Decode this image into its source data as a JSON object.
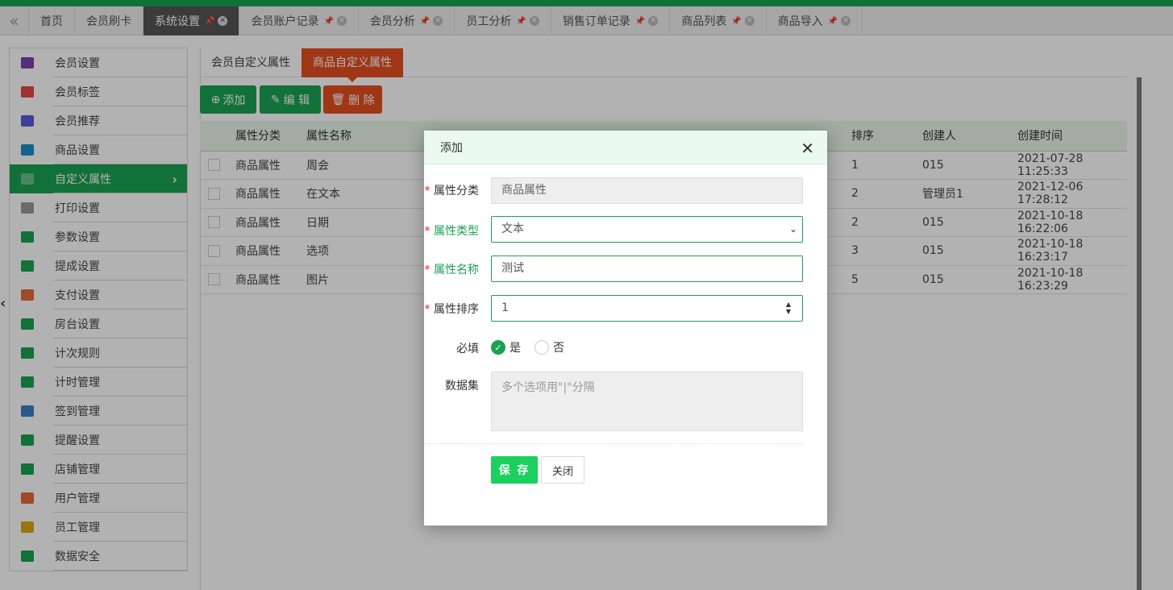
{
  "tabs": [
    {
      "label": "首页"
    },
    {
      "label": "会员刷卡"
    },
    {
      "label": "系统设置"
    },
    {
      "label": "会员账户记录"
    },
    {
      "label": "会员分析"
    },
    {
      "label": "员工分析"
    },
    {
      "label": "销售订单记录"
    },
    {
      "label": "商品列表"
    },
    {
      "label": "商品导入"
    }
  ],
  "sidebar": {
    "items": [
      {
        "label": "会员设置",
        "color": "#7a3fa8"
      },
      {
        "label": "会员标签",
        "color": "#e04848"
      },
      {
        "label": "会员推荐",
        "color": "#5b5bd6"
      },
      {
        "label": "商品设置",
        "color": "#1e8fc9"
      },
      {
        "label": "自定义属性",
        "color": "#1aa251"
      },
      {
        "label": "打印设置",
        "color": "#9a9a9a"
      },
      {
        "label": "参数设置",
        "color": "#1aa251"
      },
      {
        "label": "提成设置",
        "color": "#1aa251"
      },
      {
        "label": "支付设置",
        "color": "#e46a3a"
      },
      {
        "label": "房台设置",
        "color": "#1aa251"
      },
      {
        "label": "计次规则",
        "color": "#1aa251"
      },
      {
        "label": "计时管理",
        "color": "#1aa251"
      },
      {
        "label": "签到管理",
        "color": "#3a7ebf"
      },
      {
        "label": "提醒设置",
        "color": "#1aa251"
      },
      {
        "label": "店铺管理",
        "color": "#1aa251"
      },
      {
        "label": "用户管理",
        "color": "#e46a3a"
      },
      {
        "label": "员工管理",
        "color": "#d8a91a"
      },
      {
        "label": "数据安全",
        "color": "#1aa251"
      }
    ]
  },
  "subtabs": [
    "会员自定义属性",
    "商品自定义属性"
  ],
  "toolbar": {
    "add": "添加",
    "edit": "编 辑",
    "delete": "删 除"
  },
  "table": {
    "headers": [
      "属性分类",
      "属性名称",
      "排序",
      "创建人",
      "创建时间"
    ],
    "rows": [
      {
        "cat": "商品属性",
        "name": "周会",
        "order": "1",
        "creator": "015",
        "time": "2021-07-28 11:25:33"
      },
      {
        "cat": "商品属性",
        "name": "在文本",
        "order": "2",
        "creator": "管理员1",
        "time": "2021-12-06 17:28:12"
      },
      {
        "cat": "商品属性",
        "name": "日期",
        "order": "2",
        "creator": "015",
        "time": "2021-10-18 16:22:06"
      },
      {
        "cat": "商品属性",
        "name": "选项",
        "order": "3",
        "creator": "015",
        "time": "2021-10-18 16:23:17"
      },
      {
        "cat": "商品属性",
        "name": "图片",
        "order": "5",
        "creator": "015",
        "time": "2021-10-18 16:23:29"
      }
    ]
  },
  "modal": {
    "title": "添加",
    "category_label": "属性分类",
    "category_value": "商品属性",
    "type_label": "属性类型",
    "type_value": "文本",
    "name_label": "属性名称",
    "name_value": "测试",
    "order_label": "属性排序",
    "order_value": "1",
    "required_label": "必填",
    "yes": "是",
    "no": "否",
    "dataset_label": "数据集",
    "dataset_placeholder": "多个选项用\"|\"分隔",
    "save": "保 存",
    "close": "关闭"
  }
}
